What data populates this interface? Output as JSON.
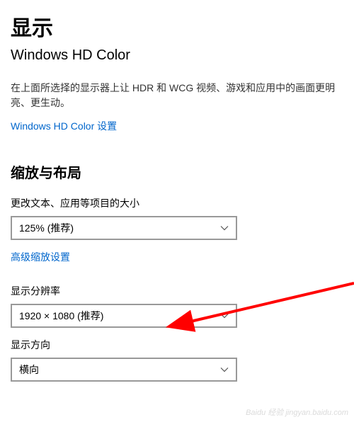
{
  "page_title": "显示",
  "hd_color": {
    "title": "Windows HD Color",
    "description": "在上面所选择的显示器上让 HDR 和 WCG 视频、游戏和应用中的画面更明亮、更生动。",
    "link": "Windows HD Color 设置"
  },
  "scaling": {
    "heading": "缩放与布局",
    "scale_label": "更改文本、应用等项目的大小",
    "scale_value": "125% (推荐)",
    "advanced_link": "高级缩放设置",
    "resolution_label": "显示分辨率",
    "resolution_value": "1920 × 1080 (推荐)",
    "orientation_label": "显示方向",
    "orientation_value": "横向"
  },
  "watermark": "Baidu 经验  jingyan.baidu.com"
}
